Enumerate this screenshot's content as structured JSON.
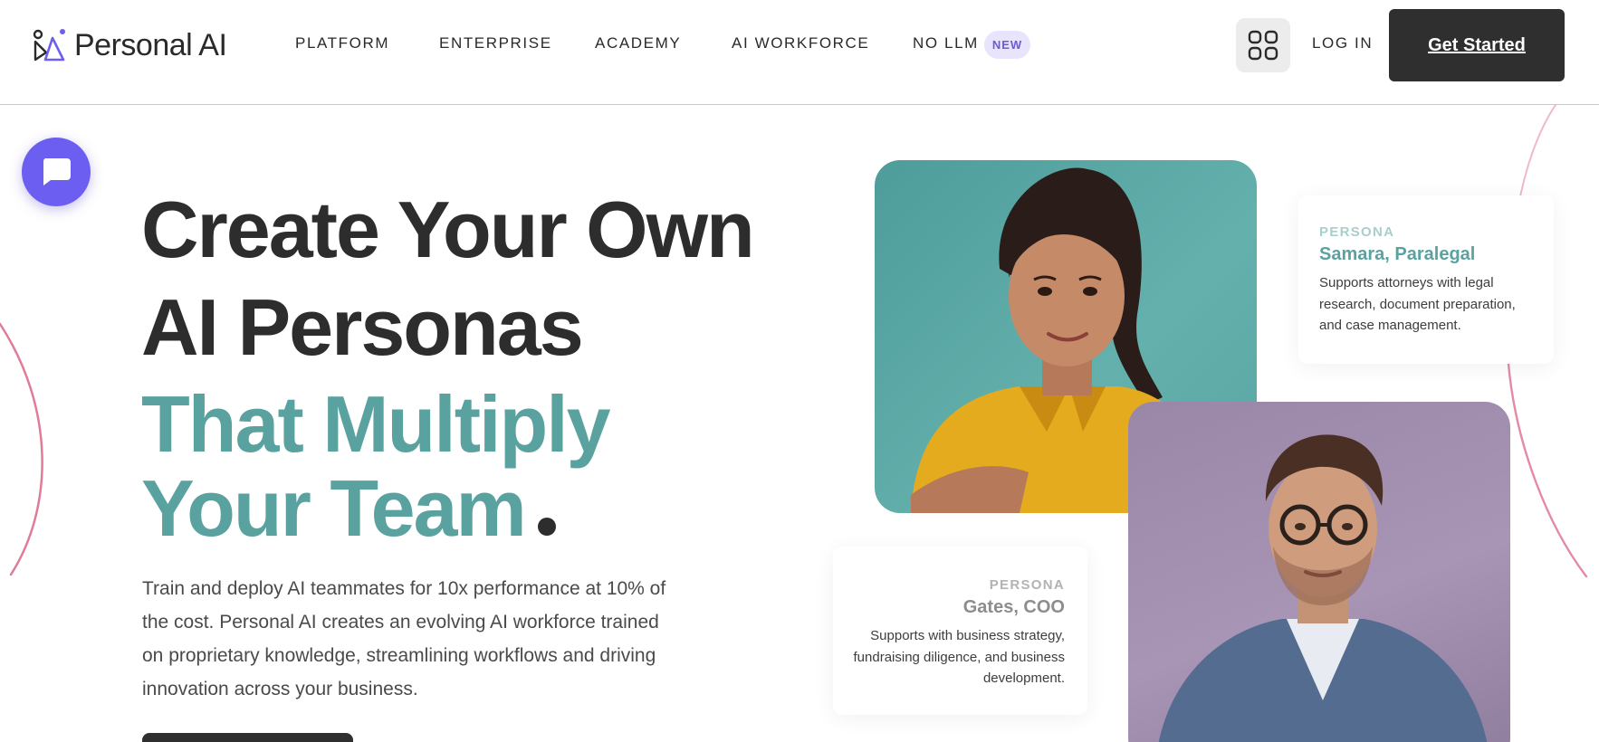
{
  "brand": {
    "name": "Personal AI",
    "logo_icon": "personal-ai-logo-icon"
  },
  "nav": {
    "items": [
      {
        "label": "PLATFORM"
      },
      {
        "label": "ENTERPRISE"
      },
      {
        "label": "ACADEMY"
      },
      {
        "label": "AI WORKFORCE"
      },
      {
        "label": "NO LLM",
        "badge": "NEW"
      }
    ],
    "apps_icon": "grid-icon",
    "login_label": "LOG IN",
    "cta_label": "Get Started"
  },
  "chat": {
    "icon": "chat-bubble-icon"
  },
  "hero": {
    "line1": "Create Your Own",
    "line2": "AI Personas",
    "line3": "That Multiply",
    "line4": "Your Team",
    "description": "Train and deploy AI teammates for 10x performance at 10% of the cost. Personal AI creates an evolving AI workforce trained on proprietary knowledge, streamlining workflows and driving innovation across your business."
  },
  "personas": [
    {
      "label": "PERSONA",
      "name": "Samara, Paralegal",
      "description": "Supports attorneys with legal research, document preparation, and case management."
    },
    {
      "label": "PERSONA",
      "name": "Gates, COO",
      "description": "Supports with business strategy, fundraising diligence, and business development."
    }
  ],
  "colors": {
    "accent_teal": "#5aa2a0",
    "chat_purple": "#6b5ef0",
    "dark": "#2f2f2f",
    "arc_pink": "#e06f8f"
  }
}
